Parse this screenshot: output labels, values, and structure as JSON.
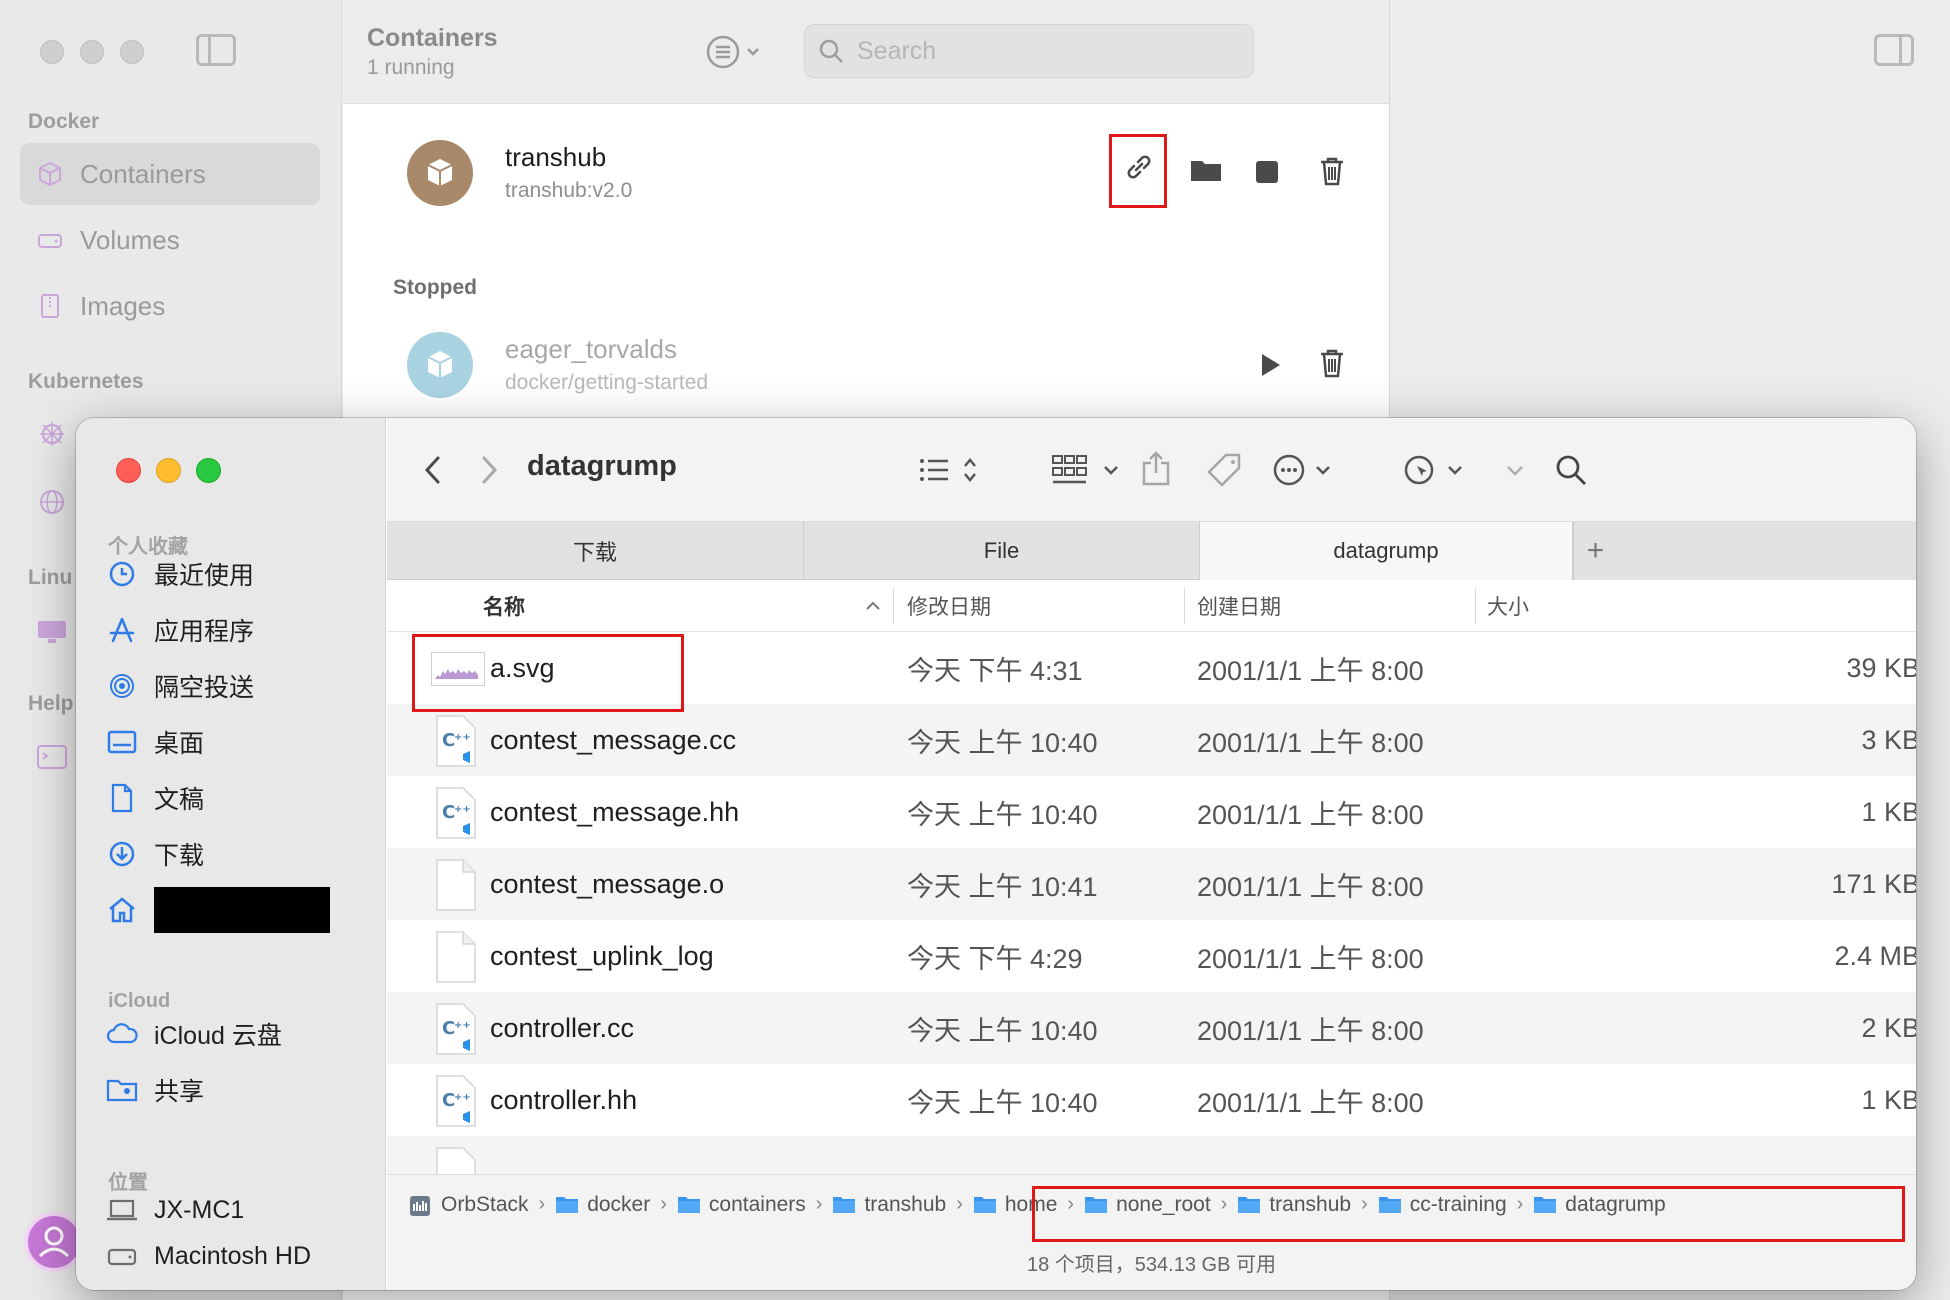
{
  "orbstack": {
    "title": "Containers",
    "subtitle": "1 running",
    "search_placeholder": "Search",
    "sidebar": {
      "sections": [
        {
          "label": "Docker"
        },
        {
          "label": "Kubernetes"
        },
        {
          "label": "Linu"
        },
        {
          "label": "Help"
        }
      ],
      "items": [
        {
          "label": "Containers",
          "selected": true
        },
        {
          "label": "Volumes"
        },
        {
          "label": "Images"
        }
      ]
    },
    "running": [
      {
        "name": "transhub",
        "image": "transhub:v2.0"
      }
    ],
    "stopped_label": "Stopped",
    "stopped": [
      {
        "name": "eager_torvalds",
        "image": "docker/getting-started"
      }
    ]
  },
  "finder": {
    "title": "datagrump",
    "sidebar": {
      "favorites_label": "个人收藏",
      "favorites": [
        "最近使用",
        "应用程序",
        "隔空投送",
        "桌面",
        "文稿",
        "下载",
        ""
      ],
      "icloud_label": "iCloud",
      "icloud": [
        "iCloud 云盘",
        "共享"
      ],
      "locations_label": "位置",
      "locations": [
        "JX-MC1",
        "Macintosh HD"
      ]
    },
    "tabs": [
      "下载",
      "File",
      "datagrump"
    ],
    "columns": {
      "name": "名称",
      "modified": "修改日期",
      "created": "创建日期",
      "size": "大小"
    },
    "files": [
      {
        "name": "a.svg",
        "modified": "今天 下午 4:31",
        "created": "2001/1/1 上午 8:00",
        "size": "39 KB",
        "icon": "svg-thumb-icon"
      },
      {
        "name": "contest_message.cc",
        "modified": "今天 上午 10:40",
        "created": "2001/1/1 上午 8:00",
        "size": "3 KB",
        "icon": "cpp-file-icon"
      },
      {
        "name": "contest_message.hh",
        "modified": "今天 上午 10:40",
        "created": "2001/1/1 上午 8:00",
        "size": "1 KB",
        "icon": "cpp-file-icon"
      },
      {
        "name": "contest_message.o",
        "modified": "今天 上午 10:41",
        "created": "2001/1/1 上午 8:00",
        "size": "171 KB",
        "icon": "blank-file-icon"
      },
      {
        "name": "contest_uplink_log",
        "modified": "今天 下午 4:29",
        "created": "2001/1/1 上午 8:00",
        "size": "2.4 MB",
        "icon": "blank-file-icon"
      },
      {
        "name": "controller.cc",
        "modified": "今天 上午 10:40",
        "created": "2001/1/1 上午 8:00",
        "size": "2 KB",
        "icon": "cpp-file-icon"
      },
      {
        "name": "controller.hh",
        "modified": "今天 上午 10:40",
        "created": "2001/1/1 上午 8:00",
        "size": "1 KB",
        "icon": "cpp-file-icon"
      }
    ],
    "path": [
      "OrbStack",
      "docker",
      "containers",
      "transhub",
      "home",
      "none_root",
      "transhub",
      "cc-training",
      "datagrump"
    ],
    "status": "18 个项目，534.13 GB 可用"
  },
  "colors": {
    "highlight": "#e01818",
    "finder_accent": "#2f7ce6",
    "container_running": "#a88a6a",
    "container_stopped": "#aad3e2"
  }
}
